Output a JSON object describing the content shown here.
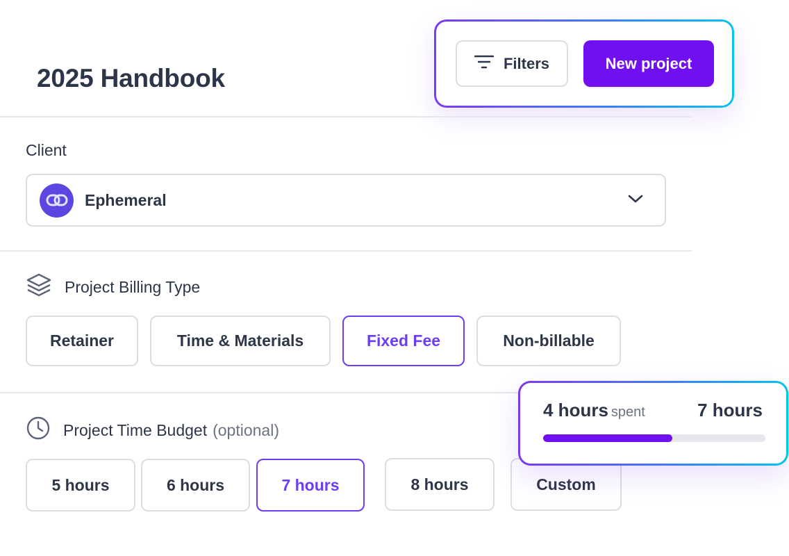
{
  "header": {
    "title": "2025 Handbook",
    "filters_label": "Filters",
    "new_project_label": "New project"
  },
  "client": {
    "label": "Client",
    "selected": "Ephemeral",
    "logo_icon": "link-icon"
  },
  "billing": {
    "heading": "Project Billing Type",
    "icon": "layers-icon",
    "options": [
      {
        "label": "Retainer",
        "selected": false
      },
      {
        "label": "Time & Materials",
        "selected": false
      },
      {
        "label": "Fixed Fee",
        "selected": true
      },
      {
        "label": "Non-billable",
        "selected": false
      }
    ]
  },
  "budget": {
    "heading": "Project Time Budget",
    "optional": "(optional)",
    "icon": "clock-icon",
    "options": [
      {
        "label": "5 hours",
        "selected": false
      },
      {
        "label": "6 hours",
        "selected": false
      },
      {
        "label": "7 hours",
        "selected": true
      },
      {
        "label": "8 hours",
        "selected": false
      },
      {
        "label": "Custom",
        "selected": false
      }
    ]
  },
  "budget_card": {
    "spent": "4 hours",
    "spent_label": "spent",
    "total": "7 hours",
    "progress_fraction": 0.58
  },
  "colors": {
    "accent": "#7010f0",
    "selected_border": "#6d3df0",
    "text": "#2d3648"
  }
}
